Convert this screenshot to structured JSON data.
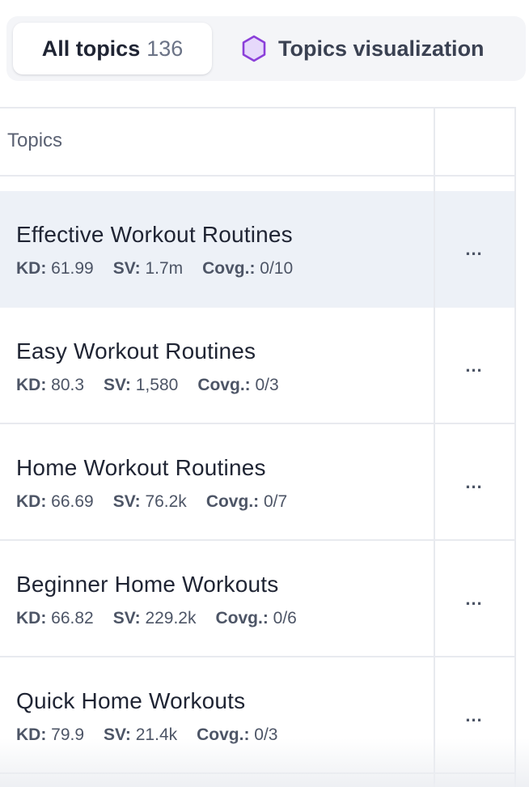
{
  "tabs": {
    "all_label": "All topics",
    "all_count": "136",
    "viz_label": "Topics visualization"
  },
  "table": {
    "header": "Topics",
    "more_label": "...",
    "rows": [
      {
        "title": "Effective Workout Routines",
        "kd_label": "KD:",
        "kd": "61.99",
        "sv_label": "SV:",
        "sv": "1.7m",
        "covg_label": "Covg.:",
        "covg": "0/10",
        "selected": true
      },
      {
        "title": "Easy Workout Routines",
        "kd_label": "KD:",
        "kd": "80.3",
        "sv_label": "SV:",
        "sv": "1,580",
        "covg_label": "Covg.:",
        "covg": "0/3"
      },
      {
        "title": "Home Workout Routines",
        "kd_label": "KD:",
        "kd": "66.69",
        "sv_label": "SV:",
        "sv": "76.2k",
        "covg_label": "Covg.:",
        "covg": "0/7"
      },
      {
        "title": "Beginner Home Workouts",
        "kd_label": "KD:",
        "kd": "66.82",
        "sv_label": "SV:",
        "sv": "229.2k",
        "covg_label": "Covg.:",
        "covg": "0/6"
      },
      {
        "title": "Quick Home Workouts",
        "kd_label": "KD:",
        "kd": "79.9",
        "sv_label": "SV:",
        "sv": "21.4k",
        "covg_label": "Covg.:",
        "covg": "0/3"
      }
    ]
  },
  "colors": {
    "accent_purple": "#8b3fd9",
    "hex_fill": "#e6d9fb",
    "selected_row": "#edf1f7"
  },
  "icons": {
    "viz": "hexagon-icon",
    "more": "more-horizontal-icon"
  }
}
